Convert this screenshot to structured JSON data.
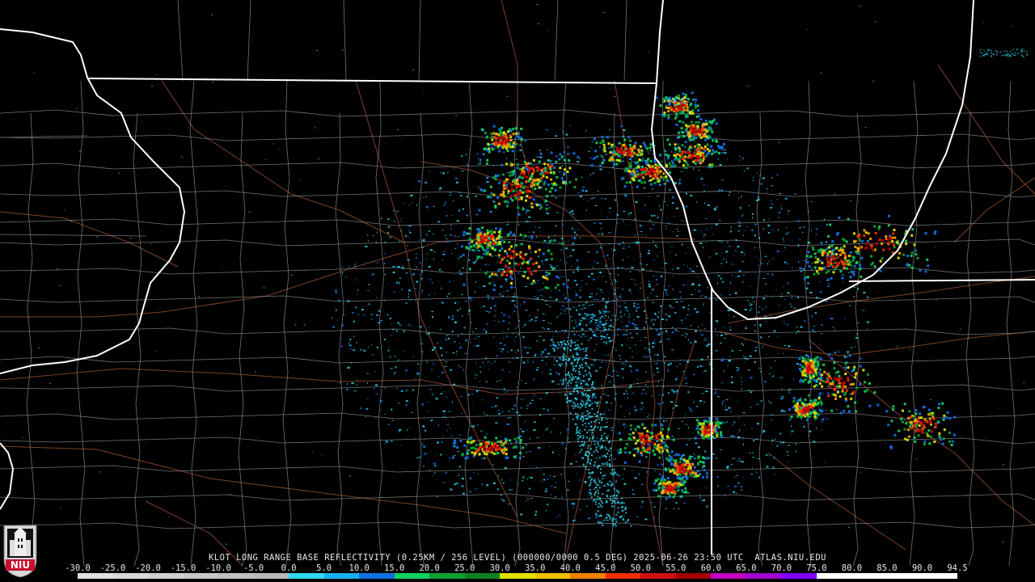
{
  "caption": "KLOT LONG RANGE BASE REFLECTIVITY (0.25KM / 256 LEVEL) (000000/0000 0.5 DEG) 2025-06-26 23:50 UTC  ATLAS.NIU.EDU",
  "scale": {
    "labels": [
      "-30.0",
      "-25.0",
      "-20.0",
      "-15.0",
      "-10.0",
      "-5.0",
      "0.0",
      "5.0",
      "10.0",
      "15.0",
      "20.0",
      "25.0",
      "30.0",
      "35.0",
      "40.0",
      "45.0",
      "50.0",
      "55.0",
      "60.0",
      "65.0",
      "70.0",
      "75.0",
      "80.0",
      "85.0",
      "90.0",
      "94.5"
    ],
    "colors": [
      "#e0e0e0",
      "#d8d8d8",
      "#d0d0d0",
      "#c8c8c8",
      "#c0c0c0",
      "#b8b8b8",
      "#30d8f0",
      "#1ab0f0",
      "#1070e0",
      "#10d060",
      "#10a030",
      "#108020",
      "#e0e000",
      "#f0c000",
      "#f08000",
      "#f03000",
      "#d01010",
      "#a00000",
      "#c000c0",
      "#a000d0",
      "#8000ff",
      "#ffffff",
      "#ffffff",
      "#ffffff",
      "#ffffff"
    ]
  },
  "logo": {
    "text": "NIU",
    "color": "#c8102e"
  },
  "colors": {
    "state_border": "#ffffff",
    "county_border": "#9a9a9a",
    "road": "#8a4a2a"
  }
}
